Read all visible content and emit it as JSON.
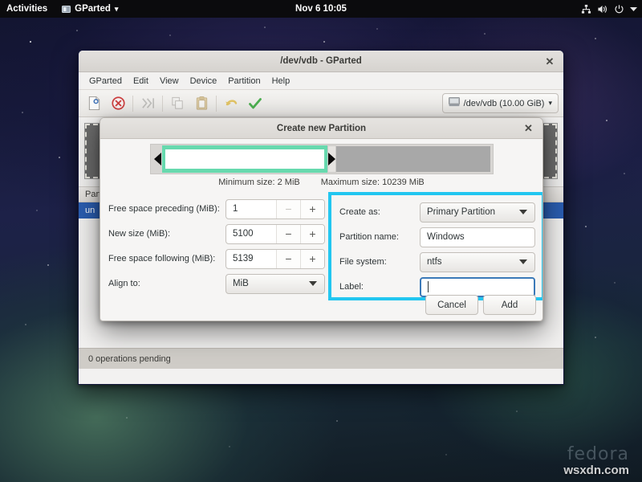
{
  "topbar": {
    "activities": "Activities",
    "app_name": "GParted",
    "app_menu_arrow": "▾",
    "clock": "Nov 6  10:05",
    "icons": [
      "network-wired-icon",
      "volume-icon",
      "power-icon",
      "chevron-down-icon"
    ]
  },
  "main_window": {
    "title": "/dev/vdb - GParted",
    "close_label": "✕",
    "menus": [
      "GParted",
      "Edit",
      "View",
      "Device",
      "Partition",
      "Help"
    ],
    "toolbar_icons": [
      "new-partition-icon",
      "delete-partition-icon",
      "resize-move-icon",
      "copy-icon",
      "paste-icon",
      "undo-icon",
      "apply-icon"
    ],
    "device_combo": {
      "icon": "harddisk-icon",
      "value": "/dev/vdb (10.00 GiB)",
      "arrow": "▾"
    },
    "table": {
      "headers": [
        "Part"
      ],
      "selected_row": [
        "un"
      ]
    },
    "statusbar": "0 operations pending"
  },
  "dialog": {
    "title": "Create new Partition",
    "close_label": "✕",
    "minimum_size": "Minimum size: 2 MiB",
    "maximum_size": "Maximum size: 10239 MiB",
    "left_fields": [
      {
        "label": "Free space preceding (MiB):",
        "value": "1",
        "minus": "−",
        "plus": "+",
        "minus_disabled": true
      },
      {
        "label": "New size (MiB):",
        "value": "5100",
        "minus": "−",
        "plus": "+",
        "minus_disabled": false
      },
      {
        "label": "Free space following (MiB):",
        "value": "5139",
        "minus": "−",
        "plus": "+",
        "minus_disabled": false
      }
    ],
    "align_to": {
      "label": "Align to:",
      "value": "MiB"
    },
    "right_fields": {
      "create_as": {
        "label": "Create as:",
        "value": "Primary Partition"
      },
      "partition_name": {
        "label": "Partition name:",
        "value": "Windows",
        "placeholder": ""
      },
      "file_system": {
        "label": "File system:",
        "value": "ntfs"
      },
      "label_field": {
        "label": "Label:",
        "value": "",
        "placeholder": ""
      }
    },
    "buttons": {
      "cancel": "Cancel",
      "add": "Add"
    }
  },
  "watermarks": {
    "fedora": "fedora",
    "site": "wsxdn.com"
  },
  "colors": {
    "highlight": "#22c6f0",
    "partition_green": "#67d9ae",
    "selection_blue": "#2a5db0",
    "focus_blue": "#3b79b8",
    "topbar_bg": "#0b0b0d"
  }
}
